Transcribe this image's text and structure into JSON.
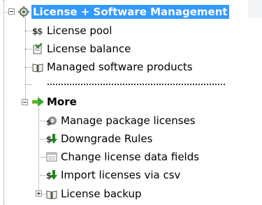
{
  "tree": {
    "root": {
      "label": "License + Software Management",
      "icon": "gear-icon"
    },
    "items": [
      {
        "label": "License pool",
        "icon": "license-pool-icon"
      },
      {
        "label": "License balance",
        "icon": "license-balance-icon"
      },
      {
        "label": "Managed software products",
        "icon": "book-icon"
      }
    ],
    "more": {
      "label": "More",
      "icon": "arrow-right-icon",
      "children": [
        {
          "label": "Manage package licenses",
          "icon": "package-license-icon"
        },
        {
          "label": "Downgrade Rules",
          "icon": "downgrade-icon"
        },
        {
          "label": "Change license data fields",
          "icon": "data-fields-icon"
        },
        {
          "label": "Import licenses via csv",
          "icon": "import-csv-icon"
        },
        {
          "label": "License backup",
          "icon": "book-icon"
        }
      ]
    }
  },
  "colors": {
    "selection": "#3399ff",
    "arrow": "#22aa22"
  }
}
